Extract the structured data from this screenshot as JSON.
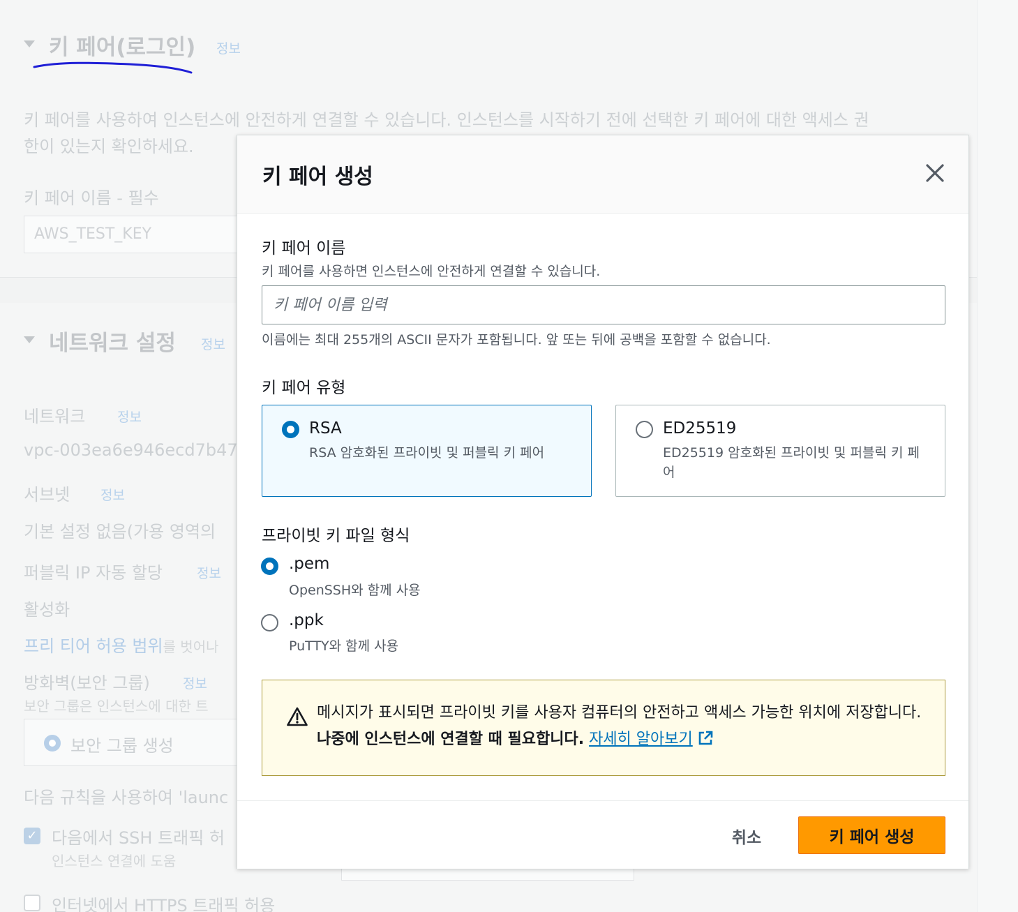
{
  "background": {
    "keypair_section": {
      "title": "키 페어(로그인)",
      "info": "정보",
      "description_line1": "키 페어를 사용하여 인스턴스에 안전하게 연결할 수 있습니다. 인스턴스를 시작하기 전에 선택한 키 페어에 대한 액세스 권",
      "description_line2": "한이 있는지 확인하세요.",
      "name_label": "키 페어 이름 - 필수",
      "name_value": "AWS_TEST_KEY"
    },
    "network_section": {
      "title": "네트워크 설정",
      "info": "정보",
      "network_label": "네트워크",
      "network_info": "정보",
      "network_value": "vpc-003ea6e946ecd7b47",
      "subnet_label": "서브넷",
      "subnet_info": "정보",
      "subnet_value": "기본 설정 없음(가용 영역의",
      "public_ip_label": "퍼블릭 IP 자동 할당",
      "public_ip_info": "정보",
      "public_ip_value": "활성화",
      "free_tier_link": "프리 티어 허용 범위",
      "free_tier_suffix": "를 벗어나",
      "firewall_label": "방화벽(보안 그룹)",
      "firewall_info": "정보",
      "firewall_desc": "보안 그룹은 인스턴스에 대한 트",
      "create_sg": "보안 그룹 생성",
      "rules_text": "다음 규칙을 사용하여 'launc",
      "ssh_label": "다음에서 SSH 트래픽 허",
      "ssh_desc": "인스턴스 연결에 도움",
      "https_label": "인터넷에서 HTTPS 트래픽 허용"
    }
  },
  "modal": {
    "title": "키 페어 생성",
    "name_field": {
      "label": "키 페어 이름",
      "description": "키 페어를 사용하면 인스턴스에 안전하게 연결할 수 있습니다.",
      "placeholder": "키 페어 이름 입력",
      "value": "",
      "constraint": "이름에는 최대 255개의 ASCII 문자가 포함됩니다. 앞 또는 뒤에 공백을 포함할 수 없습니다."
    },
    "type_field": {
      "label": "키 페어 유형",
      "options": [
        {
          "title": "RSA",
          "description": "RSA 암호화된 프라이빗 및 퍼블릭 키 페어",
          "selected": true
        },
        {
          "title": "ED25519",
          "description": "ED25519 암호화된 프라이빗 및 퍼블릭 키 페어",
          "selected": false
        }
      ]
    },
    "format_field": {
      "label": "프라이빗 키 파일 형식",
      "options": [
        {
          "title": ".pem",
          "description": "OpenSSH와 함께 사용",
          "selected": true
        },
        {
          "title": ".ppk",
          "description": "PuTTY와 함께 사용",
          "selected": false
        }
      ]
    },
    "alert": {
      "text": "메시지가 표시되면 프라이빗 키를 사용자 컴퓨터의 안전하고 액세스 가능한 위치에 저장합니다. ",
      "bold_text": "나중에 인스턴스에 연결할 때 필요합니다.",
      "link_text": "자세히 알아보기"
    },
    "footer": {
      "cancel_label": "취소",
      "create_label": "키 페어 생성"
    }
  },
  "colors": {
    "primary_button": "#ff9900",
    "selection_blue": "#0073bb",
    "alert_background": "#fffce9",
    "alert_border": "#ab9a3a",
    "annotation_scribble": "#1f1fd6"
  }
}
